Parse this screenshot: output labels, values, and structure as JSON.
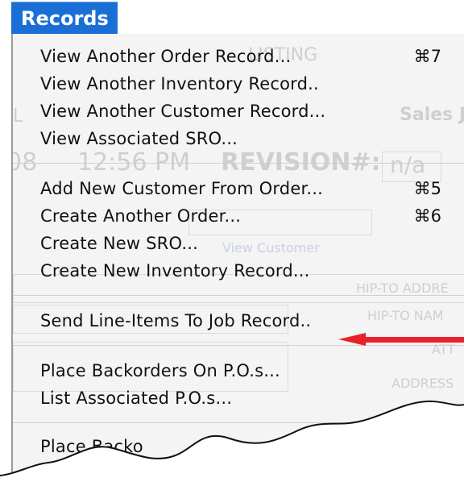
{
  "menu": {
    "title": "Records",
    "items": [
      {
        "label": "View Another Order Record...",
        "shortcut": "⌘7"
      },
      {
        "label": "View Another Inventory Record..",
        "shortcut": ""
      },
      {
        "label": "View Another Customer Record...",
        "shortcut": ""
      },
      {
        "label": "View Associated SRO...",
        "shortcut": ""
      },
      {
        "label": "Add New Customer From Order...",
        "shortcut": "⌘5"
      },
      {
        "label": "Create Another Order...",
        "shortcut": "⌘6"
      },
      {
        "label": "Create New SRO...",
        "shortcut": ""
      },
      {
        "label": "Create New Inventory Record...",
        "shortcut": ""
      },
      {
        "label": "Send Line-Items To Job Record..",
        "shortcut": ""
      },
      {
        "label": "Place Backorders On P.O.s...",
        "shortcut": ""
      },
      {
        "label": "List Associated P.O.s...",
        "shortcut": ""
      },
      {
        "label": "Place Backo",
        "shortcut": ""
      }
    ]
  },
  "background_window": {
    "listing": "LISTING",
    "sales_jo": "Sales Jo",
    "time_fragment": "08",
    "time": "12:56 PM",
    "revision_label": "REVISION#:",
    "revision_value": "n/a",
    "view_customer": "View Customer",
    "ship_to_address": "HIP-TO ADDRE",
    "ship_to_name": "HIP-TO NAM",
    "att": "ATT",
    "address": "ADDRESS",
    "letter_l": "L"
  },
  "annotation": {
    "arrow_color": "#e8202a"
  }
}
